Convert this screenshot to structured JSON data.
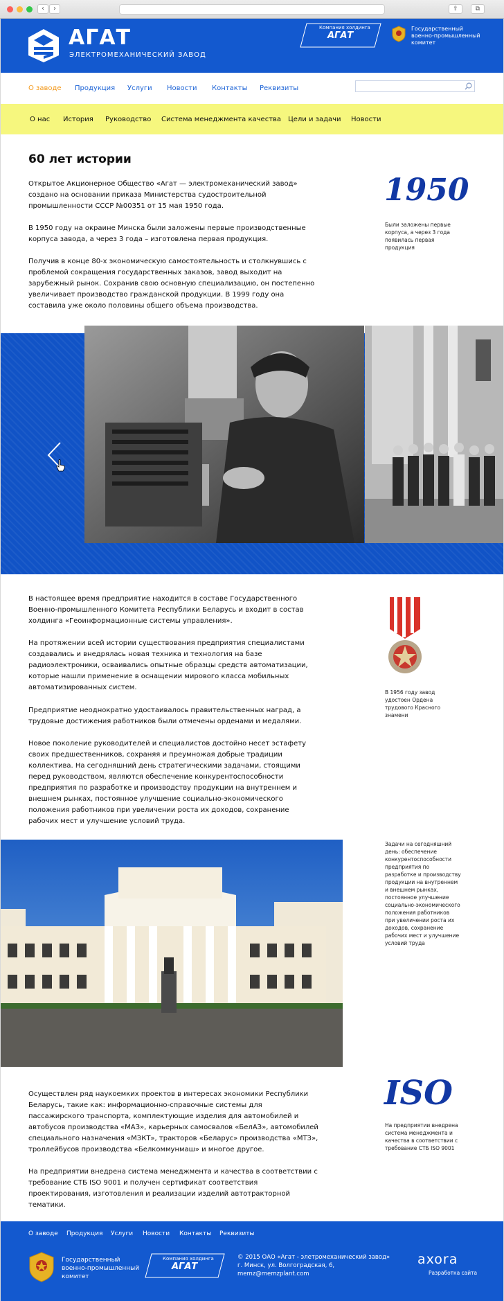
{
  "header": {
    "logo_title": "АГАТ",
    "logo_subtitle": "ЭЛЕКТРОМЕХАНИЧЕСКИЙ ЗАВОД",
    "holding_label": "Компания холдинга",
    "holding_brand": "АГАТ",
    "committee": "Государственный военно-промышленный комитет"
  },
  "topmenu": {
    "items": [
      "О заводе",
      "Продукция",
      "Услуги",
      "Новости",
      "Контакты",
      "Реквизиты"
    ],
    "search_placeholder": ""
  },
  "subnav": {
    "items": [
      "О нас",
      "История",
      "Руководство",
      "Система менеджмента качества",
      "Цели и задачи",
      "Новости"
    ]
  },
  "content": {
    "title": "60 лет истории",
    "p1": "Открытое Акционерное Общество «Агат — электромеханический завод» создано на основании приказа Министерства судостроительной промышленности СССР №00351 от 15 мая 1950 года.",
    "p2": "В 1950 году на окраине Минска были заложены первые производственные корпуса завода, а через 3 года – изготовлена первая продукция.",
    "p3": "Получив в конце 80-х экономическую самостоятельность и столкнувшись с проблемой сокращения государственных заказов, завод выходит на зарубежный рынок. Сохранив свою основную специализацию, он постепенно увеличивает производство гражданской продукции. В 1999 году она составила уже около половины общего объема производства.",
    "year": "1950",
    "year_note": "Были заложены первые корпуса, а через 3 года появилась первая продукция",
    "p4": "В настоящее время предприятие находится в составе Государственного Военно-промышленного Комитета  Республики Беларусь и входит в состав холдинга «Геоинформационные системы управления».",
    "p5": "На протяжении всей истории существования предприятия специалистами создавались и внедрялась новая техника и технология на базе радиоэлектроники, осваивались опытные образцы средств автоматизации, которые нашли применение в оснащении мирового класса мобильных автоматизированных систем.",
    "p6": "Предприятие неоднократно удостаивалось правительственных наград, а трудовые достижения работников были отмечены орденами и медалями.",
    "p7": "Новое поколение руководителей и специалистов достойно несет эстафету своих предшественников, сохраняя и преумножая добрые традиции коллектива. На сегодняшний день стратегическими задачами, стоящими перед руководством, являются обеспечение конкурентоспособности предприятия по разработке и производству продукции на внутреннем и внешнем рынках, постоянное улучшение социально-экономического положения работников при увеличении роста их доходов, сохранение рабочих мест и улучшение условий труда.",
    "order_note": "В 1956 году завод удостоен Ордена трудового Красного знамени",
    "tasks_note": "Задачи на сегодняшний день: обеспечение конкурентоспособности предприятия по разработке и производству продукции на внутреннем и внешнем рынках, постоянное улучшение социально-экономического положения работников при увеличении роста их доходов, сохранение рабочих мест и улучшение условий труда",
    "p8": "Осуществлен ряд наукоемких проектов в интересах экономики Республики Беларусь, такие как: информационно-справочные системы для пассажирского транспорта, комплектующие изделия для автомобилей и автобусов производства «МАЗ», карьерных самосвалов «БелАЗ», автомобилей специального назначения «МЗКТ», тракторов «Беларус» производства «МТЗ», троллейбусов производства «Белкоммунмаш» и многое другое.",
    "p9": " На предприятии внедрена система менеджмента и качества в соответствии с требование СТБ ISO 9001 и получен сертификат соответствия проектирования, изготовления и реализации изделий автотракторной тематики.",
    "iso": "ISO",
    "iso_note": "На предприятии внедрена система менеджмента и качества в соответствии с требование СТБ ISO 9001"
  },
  "footer": {
    "menu": [
      "О заводе",
      "Продукция",
      "Услуги",
      "Новости",
      "Контакты",
      "Реквизиты"
    ],
    "committee": "Государственный военно-промышленный комитет",
    "holding_label": "Компания холдинга",
    "holding_brand": "АГАТ",
    "copyright": "© 2015  ОАО «Агат - элетромеханический завод»",
    "address": "г. Минск, ул. Волгоградская, 6,",
    "email": "memz@memzplant.com",
    "dev_brand": "axora",
    "dev_label": "Разработка сайта"
  },
  "colors": {
    "brand_blue": "#1359cf",
    "accent_orange": "#f39a1e",
    "nav_yellow": "#f6f77e",
    "year_blue": "#1238a4"
  }
}
